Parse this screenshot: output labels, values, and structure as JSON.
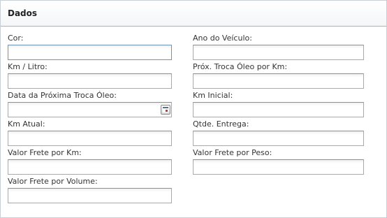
{
  "panel": {
    "title": "Dados"
  },
  "fields": {
    "cor": {
      "label": "Cor:",
      "value": ""
    },
    "ano_veiculo": {
      "label": "Ano do Veículo:",
      "value": ""
    },
    "km_litro": {
      "label": "Km / Litro:",
      "value": ""
    },
    "prox_troca_oleo_km": {
      "label": "Próx. Troca Óleo por Km:",
      "value": ""
    },
    "data_prox_troca_oleo": {
      "label": "Data da Próxima Troca Óleo:",
      "value": "",
      "button_icon": "calendar-icon"
    },
    "km_inicial": {
      "label": "Km Inicial:",
      "value": ""
    },
    "km_atual": {
      "label": "Km Atual:",
      "value": ""
    },
    "qtde_entrega": {
      "label": "Qtde. Entrega:",
      "value": ""
    },
    "valor_frete_km": {
      "label": "Valor Frete por Km:",
      "value": ""
    },
    "valor_frete_peso": {
      "label": "Valor Frete por Peso:",
      "value": ""
    },
    "valor_frete_volume": {
      "label": "Valor Frete por Volume:",
      "value": ""
    }
  },
  "colors": {
    "header_border": "#9db6cf",
    "focus_border": "#6e94be"
  }
}
